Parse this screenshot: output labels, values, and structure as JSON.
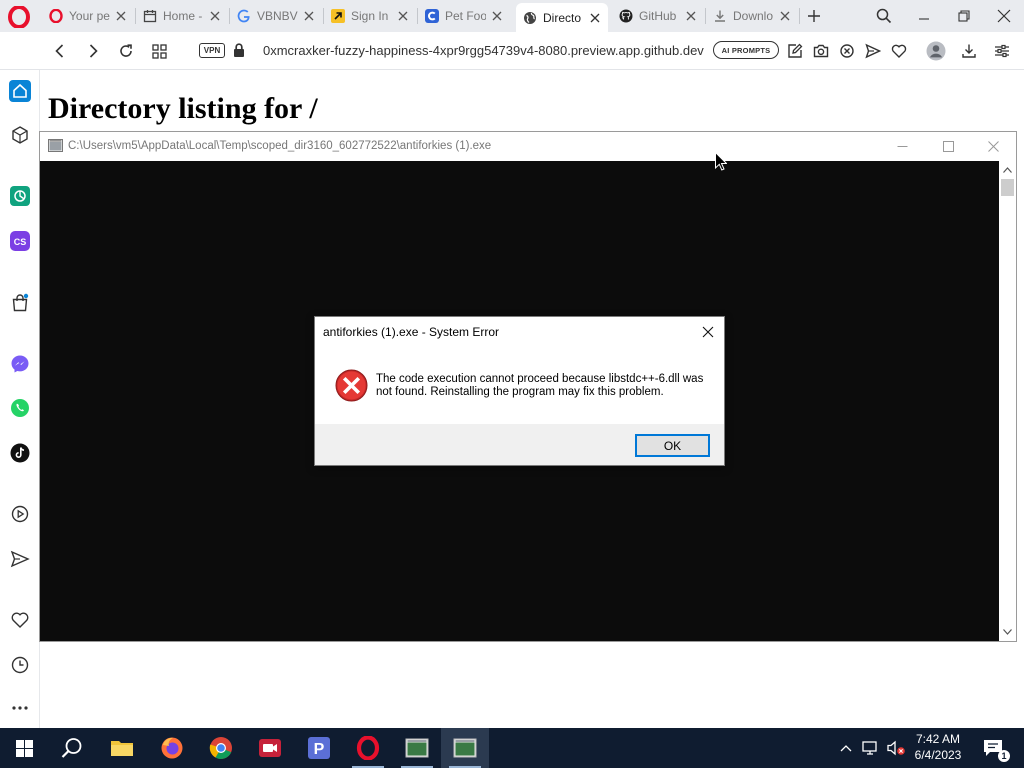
{
  "browser": {
    "tabs": [
      {
        "title": "Your pe",
        "icon": "opera-icon"
      },
      {
        "title": "Home -",
        "icon": "calendar-icon"
      },
      {
        "title": "VBNBV",
        "icon": "google-icon"
      },
      {
        "title": "Sign In",
        "icon": "arrow-logo-icon"
      },
      {
        "title": "Pet Foo",
        "icon": "c-logo-icon"
      },
      {
        "title": "Directo",
        "icon": "globe-icon",
        "active": true
      },
      {
        "title": "GitHub",
        "icon": "github-icon"
      },
      {
        "title": "Downlo",
        "icon": "download-icon"
      }
    ],
    "address": {
      "vpn_label": "VPN",
      "url": "0xmcraxker-fuzzy-happiness-4xpr9rgg54739v4-8080.preview.app.github.dev",
      "ai_label": "AI PROMPTS"
    }
  },
  "page": {
    "heading": "Directory listing for /"
  },
  "console": {
    "title": "C:\\Users\\vm5\\AppData\\Local\\Temp\\scoped_dir3160_602772522\\antiforkies (1).exe"
  },
  "dialog": {
    "title": "antiforkies (1).exe - System Error",
    "message": "The code execution cannot proceed because libstdc++-6.dll was not found. Reinstalling the program may fix this problem.",
    "ok_label": "OK"
  },
  "taskbar": {
    "time": "7:42 AM",
    "date": "6/4/2023",
    "notification_count": "1"
  },
  "colors": {
    "accent": "#0078d7",
    "error": "#d32f2f",
    "opera": "#e8102c",
    "taskbar": "#0f1c30"
  }
}
